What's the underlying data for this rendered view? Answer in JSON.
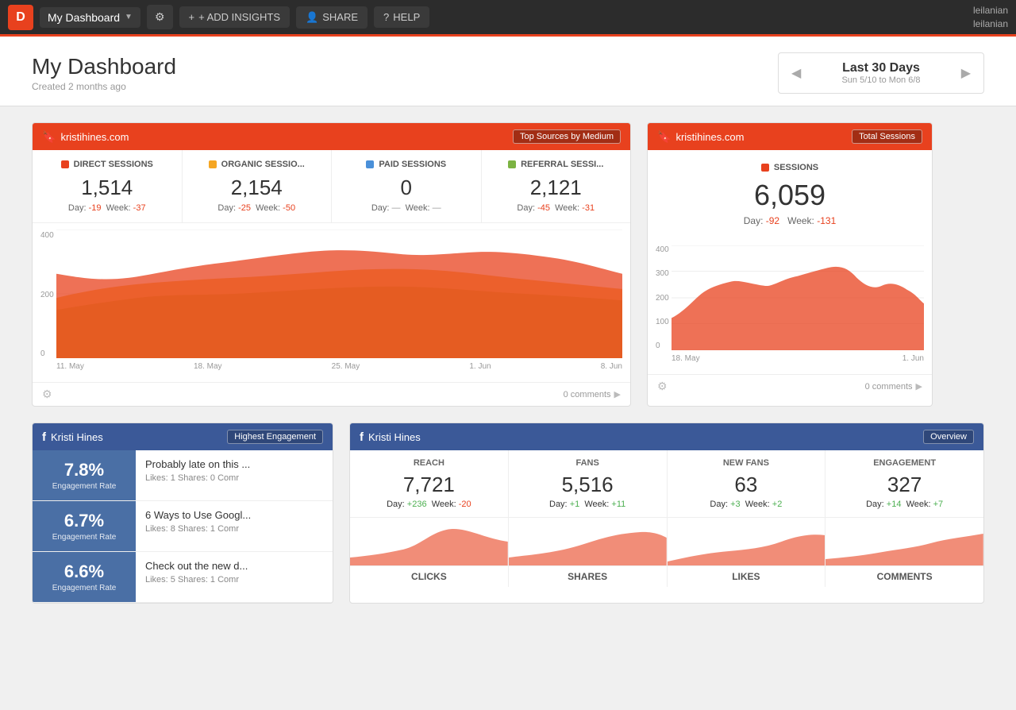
{
  "nav": {
    "logo": "D",
    "dashboard_name": "My Dashboard",
    "gear_icon": "⚙",
    "add_insights": "+ ADD INSIGHTS",
    "share_icon": "👤",
    "share": "SHARE",
    "help_icon": "?",
    "help": "HELP",
    "user_name": "leilanian",
    "user_email": "leilanian"
  },
  "page": {
    "title": "My Dashboard",
    "subtitle": "Created 2 months ago"
  },
  "date_range": {
    "label": "Last 30 Days",
    "sub": "Sun 5/10 to Mon 6/8"
  },
  "sessions_widget": {
    "site": "kristihines.com",
    "badge": "Top Sources by Medium",
    "metrics": [
      {
        "label": "DIRECT SESSIONS",
        "color": "#e8411e",
        "value": "1,514",
        "day_change": "-19",
        "week_change": "-37"
      },
      {
        "label": "ORGANIC SESSIO...",
        "color": "#f5a623",
        "value": "2,154",
        "day_change": "-25",
        "week_change": "-50"
      },
      {
        "label": "PAID SESSIONS",
        "color": "#4a90d9",
        "value": "0",
        "day_change": "—",
        "week_change": "—"
      },
      {
        "label": "REFERRAL SESSI...",
        "color": "#7cb342",
        "value": "2,121",
        "day_change": "-45",
        "week_change": "-31"
      }
    ],
    "x_labels": [
      "11. May",
      "18. May",
      "25. May",
      "1. Jun",
      "8. Jun"
    ],
    "y_labels": [
      "400",
      "200",
      "0"
    ],
    "comments": "0 comments"
  },
  "total_sessions_widget": {
    "site": "kristihines.com",
    "badge": "Total Sessions",
    "metric_label": "SESSIONS",
    "value": "6,059",
    "day_change": "-92",
    "week_change": "-131",
    "y_labels": [
      "400",
      "300",
      "200",
      "100",
      "0"
    ],
    "x_labels": [
      "18. May",
      "1. Jun"
    ],
    "comments": "0 comments"
  },
  "fb_engagement_widget": {
    "title": "Kristi Hines",
    "badge": "Highest Engagement",
    "items": [
      {
        "rate": "7.8%",
        "rate_label": "Engagement Rate",
        "title": "Probably late on this ...",
        "meta": "Likes: 1   Shares: 0   Comr"
      },
      {
        "rate": "6.7%",
        "rate_label": "Engagement Rate",
        "title": "6 Ways to Use Googl...",
        "meta": "Likes: 8   Shares: 1   Comr"
      },
      {
        "rate": "6.6%",
        "rate_label": "Engagement Rate",
        "title": "Check out the new d...",
        "meta": "Likes: 5   Shares: 1   Comr"
      }
    ]
  },
  "fb_overview_widget": {
    "title": "Kristi Hines",
    "badge": "Overview",
    "metrics": [
      {
        "label": "REACH",
        "value": "7,721",
        "day": "+236",
        "week": "-20",
        "day_pos": true,
        "week_pos": false
      },
      {
        "label": "FANS",
        "value": "5,516",
        "day": "+1",
        "week": "+11",
        "day_pos": true,
        "week_pos": true
      },
      {
        "label": "NEW FANS",
        "value": "63",
        "day": "+3",
        "week": "+2",
        "day_pos": true,
        "week_pos": true
      },
      {
        "label": "ENGAGEMENT",
        "value": "327",
        "day": "+14",
        "week": "+7",
        "day_pos": true,
        "week_pos": true
      }
    ],
    "bottom_labels": [
      "CLICKS",
      "SHARES",
      "LIKES",
      "COMMENTS"
    ]
  }
}
